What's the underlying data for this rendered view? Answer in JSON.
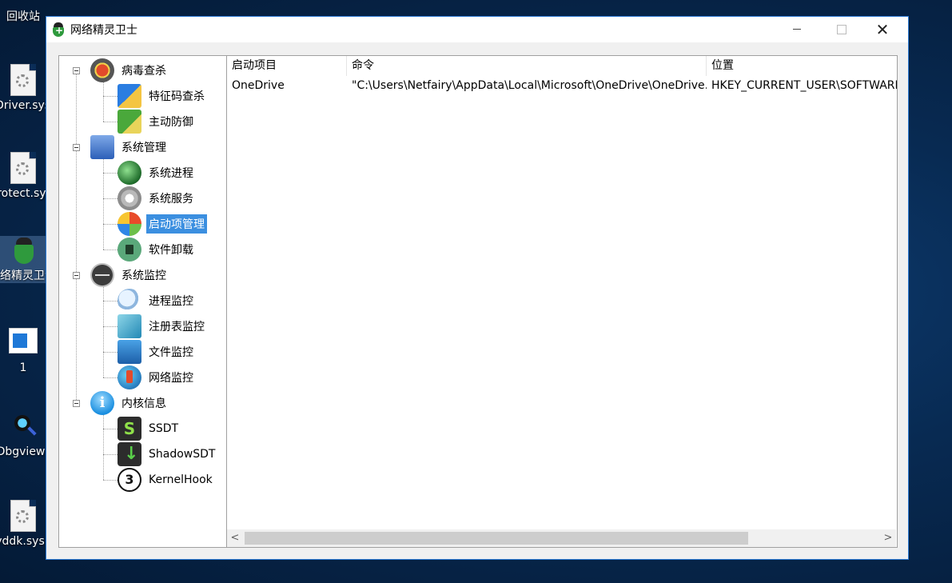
{
  "desktop": {
    "icons": [
      {
        "label": "回收站"
      },
      {
        "label": "Driver.sys"
      },
      {
        "label": "Protect.sys"
      },
      {
        "label": "网络精灵卫士"
      },
      {
        "label": "1"
      },
      {
        "label": "Dbgview"
      },
      {
        "label": "yddk.sys"
      }
    ]
  },
  "window": {
    "title": "网络精灵卫士",
    "controls": {
      "minimize": "minimize",
      "maximize": "maximize",
      "close": "✕"
    }
  },
  "tree": {
    "groups": [
      {
        "label": "病毒查杀",
        "icon": "virus-scan-icon",
        "children": [
          {
            "label": "特征码查杀",
            "icon": "signature-scan-icon"
          },
          {
            "label": "主动防御",
            "icon": "active-defense-icon"
          }
        ]
      },
      {
        "label": "系统管理",
        "icon": "system-manage-icon",
        "children": [
          {
            "label": "系统进程",
            "icon": "system-process-icon"
          },
          {
            "label": "系统服务",
            "icon": "system-service-icon"
          },
          {
            "label": "启动项管理",
            "icon": "startup-manage-icon",
            "selected": true
          },
          {
            "label": "软件卸载",
            "icon": "uninstall-icon"
          }
        ]
      },
      {
        "label": "系统监控",
        "icon": "system-monitor-icon",
        "children": [
          {
            "label": "进程监控",
            "icon": "process-monitor-icon"
          },
          {
            "label": "注册表监控",
            "icon": "registry-monitor-icon"
          },
          {
            "label": "文件监控",
            "icon": "file-monitor-icon"
          },
          {
            "label": "网络监控",
            "icon": "network-monitor-icon"
          }
        ]
      },
      {
        "label": "内核信息",
        "icon": "kernel-info-icon",
        "children": [
          {
            "label": "SSDT",
            "icon": "ssdt-icon"
          },
          {
            "label": "ShadowSDT",
            "icon": "shadow-sdt-icon"
          },
          {
            "label": "KernelHook",
            "icon": "kernel-hook-icon"
          }
        ]
      }
    ]
  },
  "list": {
    "columns": [
      "启动项目",
      "命令",
      "位置"
    ],
    "rows": [
      {
        "name": "OneDrive",
        "command": "\"C:\\Users\\Netfairy\\AppData\\Local\\Microsoft\\OneDrive\\OneDrive.…",
        "location": "HKEY_CURRENT_USER\\SOFTWARE"
      }
    ],
    "scroll_left": "<",
    "scroll_right": ">"
  }
}
